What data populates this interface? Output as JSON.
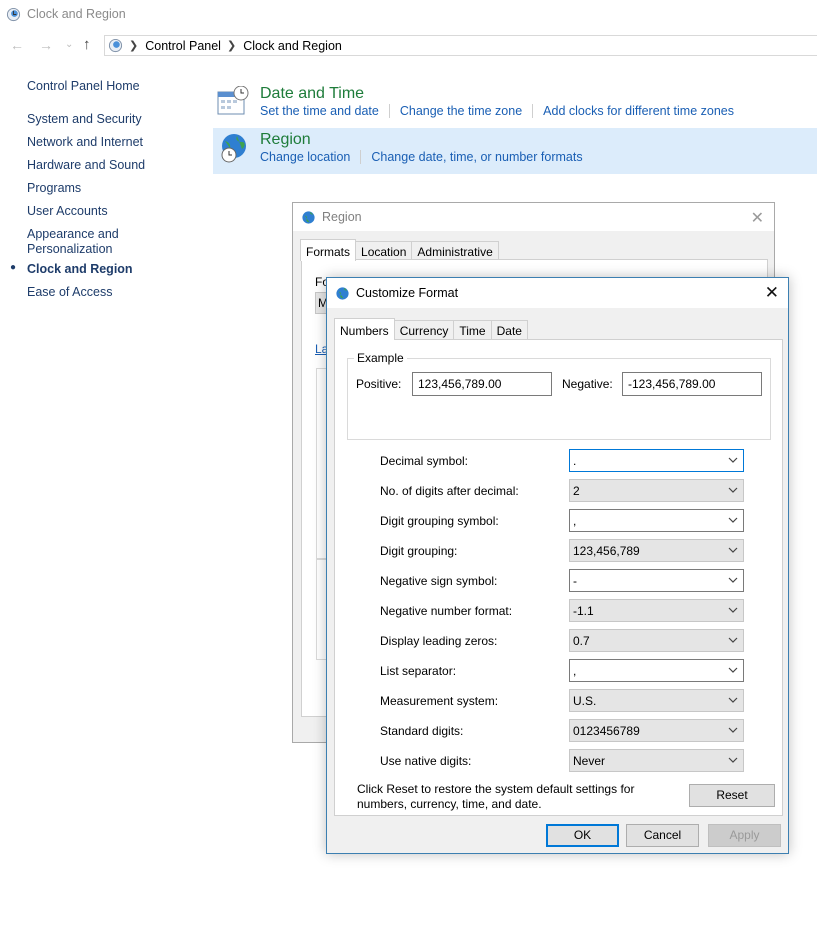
{
  "window": {
    "title": "Clock and Region"
  },
  "address": {
    "crumbs": [
      "Control Panel",
      "Clock and Region"
    ]
  },
  "leftnav": {
    "home": "Control Panel Home",
    "items": [
      "System and Security",
      "Network and Internet",
      "Hardware and Sound",
      "Programs",
      "User Accounts",
      "Appearance and\nPersonalization",
      "Clock and Region",
      "Ease of Access"
    ],
    "active": "Clock and Region"
  },
  "categories": {
    "datetime": {
      "title": "Date and Time",
      "links": [
        "Set the time and date",
        "Change the time zone",
        "Add clocks for different time zones"
      ]
    },
    "region": {
      "title": "Region",
      "links": [
        "Change location",
        "Change date, time, or number formats"
      ]
    }
  },
  "region_dialog": {
    "title": "Region",
    "tabs": [
      "Formats",
      "Location",
      "Administrative"
    ],
    "peek_texts": [
      "Fo",
      "M",
      "La"
    ]
  },
  "customize_dialog": {
    "title": "Customize Format",
    "tabs": [
      "Numbers",
      "Currency",
      "Time",
      "Date"
    ],
    "example": {
      "legend": "Example",
      "positive_label": "Positive:",
      "positive_value": "123,456,789.00",
      "negative_label": "Negative:",
      "negative_value": "-123,456,789.00"
    },
    "settings": [
      {
        "label": "Decimal symbol:",
        "value": ".",
        "editable": true
      },
      {
        "label": "No. of digits after decimal:",
        "value": "2",
        "editable": false
      },
      {
        "label": "Digit grouping symbol:",
        "value": ",",
        "editable": true
      },
      {
        "label": "Digit grouping:",
        "value": "123,456,789",
        "editable": false
      },
      {
        "label": "Negative sign symbol:",
        "value": "-",
        "editable": true
      },
      {
        "label": "Negative number format:",
        "value": "-1.1",
        "editable": false
      },
      {
        "label": "Display leading zeros:",
        "value": "0.7",
        "editable": false
      },
      {
        "label": "List separator:",
        "value": ",",
        "editable": true
      },
      {
        "label": "Measurement system:",
        "value": "U.S.",
        "editable": false
      },
      {
        "label": "Standard digits:",
        "value": "0123456789",
        "editable": false
      },
      {
        "label": "Use native digits:",
        "value": "Never",
        "editable": false
      }
    ],
    "reset_note": "Click Reset to restore the system default settings for numbers, currency, time, and date.",
    "reset_label": "Reset",
    "ok_label": "OK",
    "cancel_label": "Cancel",
    "apply_label": "Apply"
  },
  "colors": {
    "link": "#1a5fb4",
    "category_title": "#1e7c3a",
    "accent": "#0078d7",
    "highlight": "#dcecfb"
  }
}
